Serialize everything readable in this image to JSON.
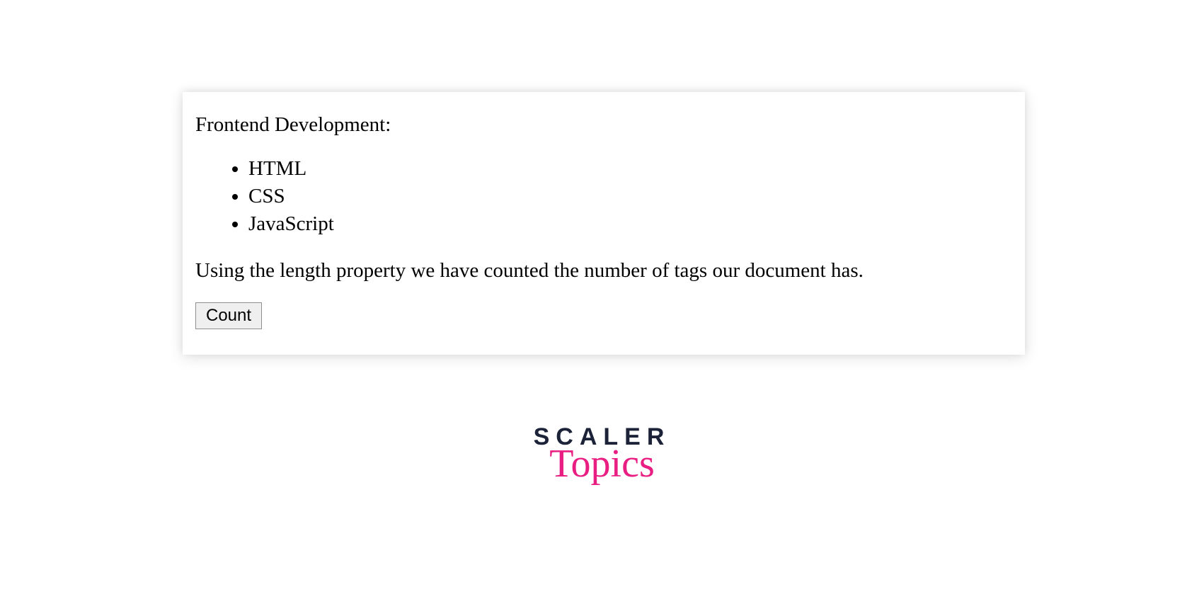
{
  "card": {
    "heading": "Frontend Development:",
    "list": [
      "HTML",
      "CSS",
      "JavaScript"
    ],
    "paragraph": "Using the length property we have counted the number of tags our document has.",
    "button_label": "Count"
  },
  "logo": {
    "line1": "SCALER",
    "line2": "Topics"
  }
}
